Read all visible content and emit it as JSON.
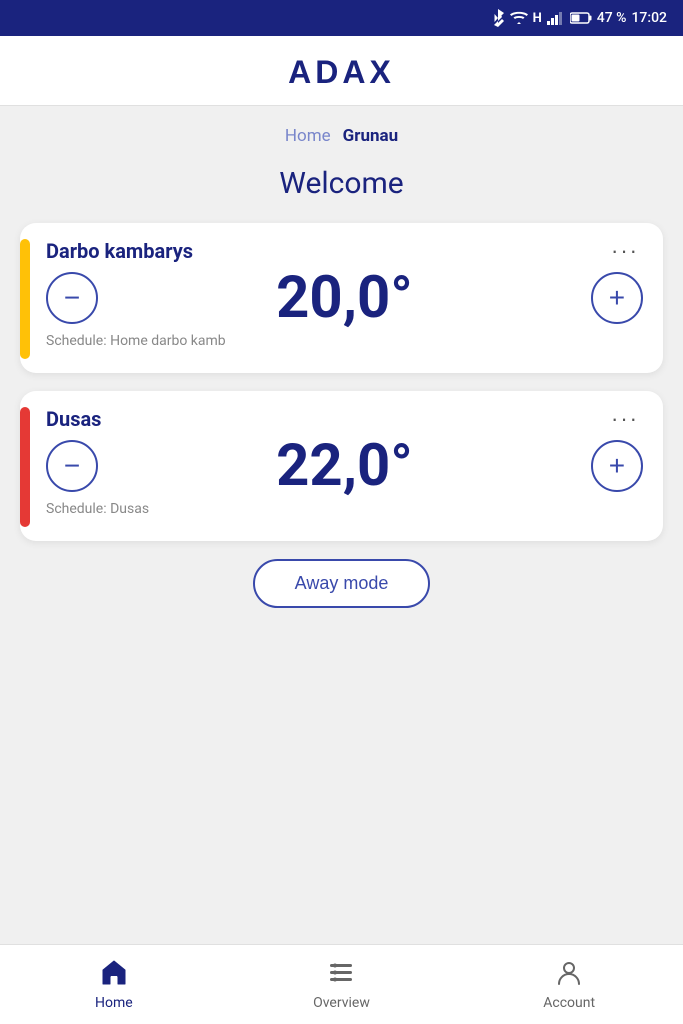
{
  "statusBar": {
    "battery": "47 %",
    "time": "17:02"
  },
  "header": {
    "logo": "ADAX"
  },
  "breadcrumb": {
    "home": "Home",
    "current": "Grunau"
  },
  "welcome": {
    "title": "Welcome"
  },
  "devices": [
    {
      "id": "darbo",
      "name": "Darbo kambarys",
      "temperature": "20,0°",
      "schedule": "Schedule: Home darbo kamb",
      "accentColor": "yellow"
    },
    {
      "id": "dusas",
      "name": "Dusas",
      "temperature": "22,0°",
      "schedule": "Schedule: Dusas",
      "accentColor": "orange"
    }
  ],
  "awayMode": {
    "label": "Away mode"
  },
  "bottomNav": {
    "items": [
      {
        "id": "home",
        "label": "Home",
        "active": true
      },
      {
        "id": "overview",
        "label": "Overview",
        "active": false
      },
      {
        "id": "account",
        "label": "Account",
        "active": false
      }
    ]
  }
}
